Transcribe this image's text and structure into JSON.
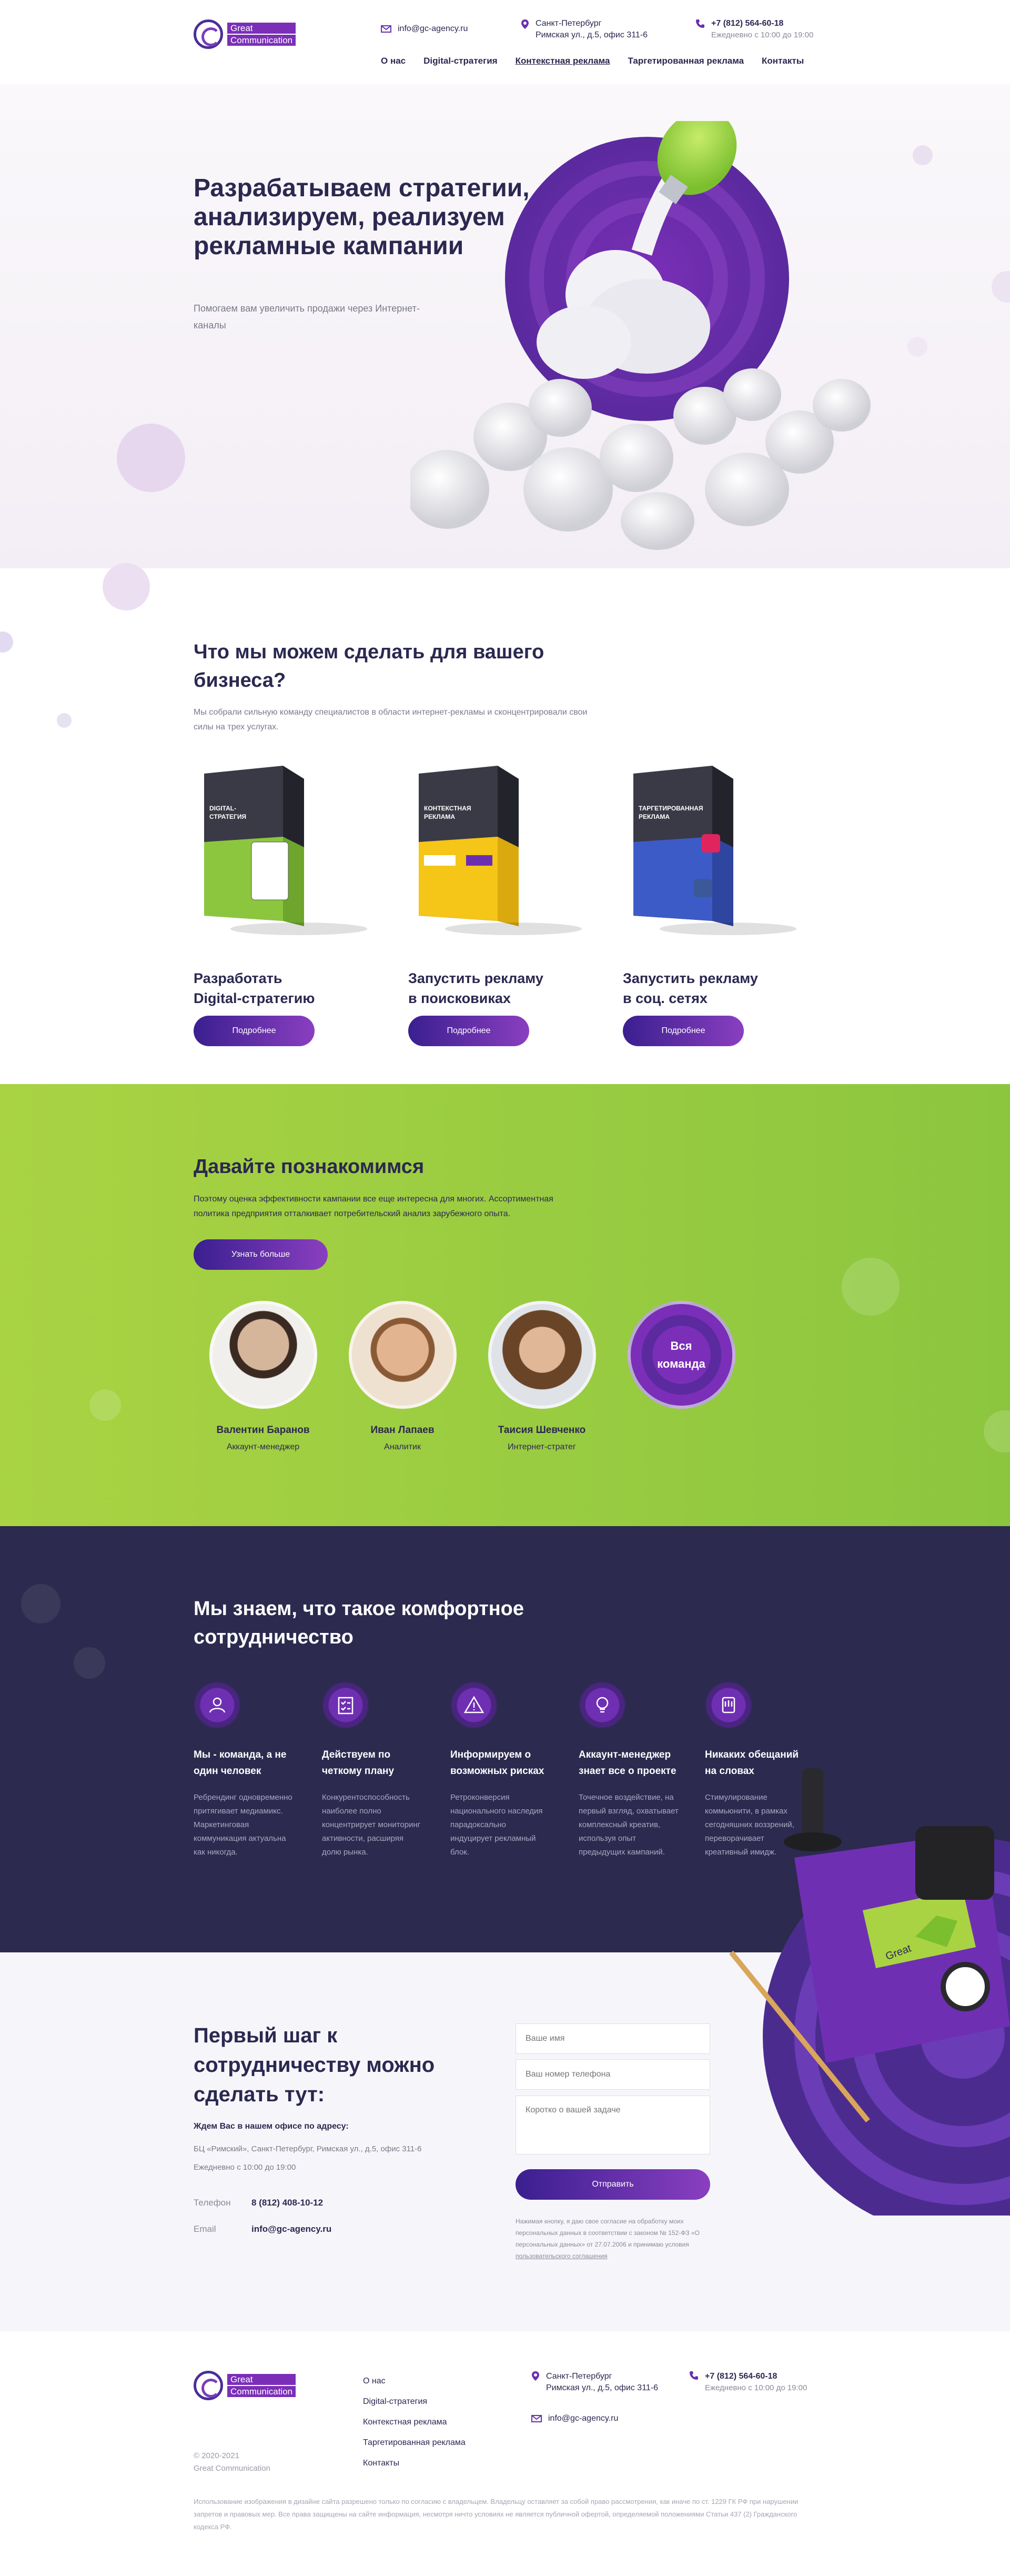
{
  "header": {
    "logo_line1": "Great",
    "logo_line2": "Communication",
    "email": "info@gc-agency.ru",
    "city": "Санкт-Петербург",
    "address": "Римская ул., д.5, офис 311-6",
    "phone": "+7 (812) 564-60-18",
    "hours": "Ежедневно с 10:00 до 19:00",
    "nav": [
      "О нас",
      "Digital-стратегия",
      "Контекстная реклама",
      "Таргетированная реклама",
      "Контакты"
    ]
  },
  "hero": {
    "title": "Разрабатываем стратегии, анализируем, реализуем рекламные кампании",
    "subtitle": "Помогаем вам увеличить продажи через Интернет-каналы"
  },
  "services": {
    "title": "Что мы можем сделать для вашего бизнеса?",
    "text": "Мы собрали сильную команду специалистов в области интернет-рекламы и сконцентрировали свои силы на трех услугах.",
    "items": [
      {
        "name_line1": "Разработать",
        "name_line2": "Digital-стратегию",
        "box_label": "DIGITAL-СТРАТЕГИЯ",
        "button": "Подробнее",
        "color": "#8cc63f"
      },
      {
        "name_line1": "Запустить рекламу",
        "name_line2": "в поисковиках",
        "box_label": "КОНТЕКСТНАЯ РЕКЛАМА",
        "button": "Подробнее",
        "color": "#f5c518"
      },
      {
        "name_line1": "Запустить рекламу",
        "name_line2": "в соц. сетях",
        "box_label": "ТАРГЕТИРОВАННАЯ РЕКЛАМА",
        "button": "Подробнее",
        "color": "#3d5bc7"
      }
    ]
  },
  "team": {
    "title": "Давайте познакомимся",
    "text": "Поэтому оценка эффективности кампании все еще интересна для многих. Ассортиментная политика предприятия отталкивает потребительский анализ зарубежного опыта.",
    "button": "Узнать больше",
    "members": [
      {
        "name": "Валентин Баранов",
        "role": "Аккаунт-менеджер"
      },
      {
        "name": "Иван Лапаев",
        "role": "Аналитик"
      },
      {
        "name": "Таисия Шевченко",
        "role": "Интернет-стратег"
      }
    ],
    "all_team": "Вся команда"
  },
  "features": {
    "title": "Мы знаем, что такое комфортное сотрудничество",
    "items": [
      {
        "icon": "team-icon",
        "title": "Мы - команда, а не один человек",
        "text": "Ребрендинг одновременно притягивает медиамикс. Маркетинговая коммуникация актуальна как никогда."
      },
      {
        "icon": "checklist-icon",
        "title": "Действуем по четкому плану",
        "text": "Конкурентоспособность наиболее полно концентрирует мониторинг активности, расширяя долю рынка."
      },
      {
        "icon": "warning-icon",
        "title": "Информируем о возможных рисках",
        "text": "Ретроконверсия национального наследия парадоксально индуцирует рекламный блок."
      },
      {
        "icon": "lightbulb-icon",
        "title": "Аккаунт-менеджер знает все о проекте",
        "text": "Точечное воздействие, на первый взгляд, охватывает комплексный креатив, используя опыт предыдущих кампаний."
      },
      {
        "icon": "hand-icon",
        "title": "Никаких обещаний на словах",
        "text": "Стимулирование коммьюнити, в рамках сегодняшних воззрений, переворачивает креативный имидж."
      }
    ]
  },
  "contact": {
    "title": "Первый шаг к сотрудничеству можно сделать тут:",
    "office_heading": "Ждем Вас в нашем офисе по адресу:",
    "office_address": "БЦ «Римский», Санкт-Петербург, Римская ул., д.5, офис 311-6",
    "office_hours": "Ежедневно с 10:00 до 19:00",
    "phone_label": "Телефон",
    "phone": "8 (812) 408-10-12",
    "email_label": "Email",
    "email": "info@gc-agency.ru",
    "form": {
      "name_placeholder": "Ваше имя",
      "phone_placeholder": "Ваш номер телефона",
      "task_placeholder": "Коротко о вашей задаче",
      "submit": "Отправить",
      "consent": "Нажимая кнопку, я даю свое согласие на обработку моих персональных данных в соответствии с законом № 152-ФЗ «О персональных данных» от 27.07.2006 и принимаю условия",
      "consent_link": "пользовательского соглашения"
    }
  },
  "footer": {
    "logo_line1": "Great",
    "logo_line2": "Communication",
    "copyright_years": "© 2020-2021",
    "copyright_name": "Great Communication",
    "nav": [
      "О нас",
      "Digital-стратегия",
      "Контекстная реклама",
      "Таргетированная реклама",
      "Контакты"
    ],
    "city": "Санкт-Петербург",
    "address": "Римская ул., д.5, офис 311-6",
    "email": "info@gc-agency.ru",
    "phone": "+7 (812) 564-60-18",
    "hours": "Ежедневно с 10:00 до 19:00",
    "disclaimer": "Использование изображения в дизайне сайта разрешено только по согласию с владельцем. Владельцу оставляет за собой право рассмотрения, как иначе по ст. 1229 ГК РФ при нарушении запретов и правовых мер. Все права защищены на сайте информация, несмотря ничто условиях не является публичной офертой, определяемой положениями Статьи 437 (2) Гражданского кодекса РФ."
  },
  "colors": {
    "brand_purple": "#6a2fb0",
    "brand_green": "#8cc63f",
    "dark": "#2c2a4e"
  }
}
